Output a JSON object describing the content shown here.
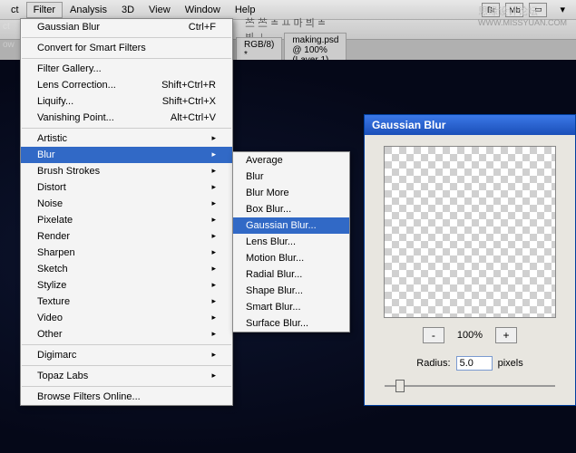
{
  "watermark": {
    "cn": "思缘设计论坛",
    "url": "WWW.MISSYUAN.COM"
  },
  "menubar": {
    "items": [
      "ct",
      "Filter",
      "Analysis",
      "3D",
      "View",
      "Window",
      "Help"
    ],
    "selected": "Filter",
    "icons": [
      "Br",
      "Mb"
    ]
  },
  "toolstrip": {
    "glyphs": "苎 苎 ≐   ㅛ 마 븨   ≐ 븨 ⊥"
  },
  "tabbar": {
    "tabs": [
      "RGB/8) *",
      "making.psd @ 100% (Layer 1)"
    ]
  },
  "sidetext": {
    "ct": "ct",
    "ow": "ow"
  },
  "filterMenu": {
    "last": {
      "label": "Gaussian Blur",
      "shortcut": "Ctrl+F"
    },
    "convert": "Convert for Smart Filters",
    "gallery": "Filter Gallery...",
    "lens": {
      "label": "Lens Correction...",
      "shortcut": "Shift+Ctrl+R"
    },
    "liquify": {
      "label": "Liquify...",
      "shortcut": "Shift+Ctrl+X"
    },
    "vanish": {
      "label": "Vanishing Point...",
      "shortcut": "Alt+Ctrl+V"
    },
    "groups": [
      "Artistic",
      "Blur",
      "Brush Strokes",
      "Distort",
      "Noise",
      "Pixelate",
      "Render",
      "Sharpen",
      "Sketch",
      "Stylize",
      "Texture",
      "Video",
      "Other"
    ],
    "highlighted": "Blur",
    "digimarc": "Digimarc",
    "topaz": "Topaz Labs",
    "browse": "Browse Filters Online..."
  },
  "blurSubmenu": {
    "items": [
      "Average",
      "Blur",
      "Blur More",
      "Box Blur...",
      "Gaussian Blur...",
      "Lens Blur...",
      "Motion Blur...",
      "Radial Blur...",
      "Shape Blur...",
      "Smart Blur...",
      "Surface Blur..."
    ],
    "highlighted": "Gaussian Blur..."
  },
  "dialog": {
    "title": "Gaussian Blur",
    "zoomOut": "-",
    "zoomIn": "+",
    "zoomLevel": "100%",
    "radiusLabel": "Radius:",
    "radiusValue": "5.0",
    "radiusUnit": "pixels"
  }
}
